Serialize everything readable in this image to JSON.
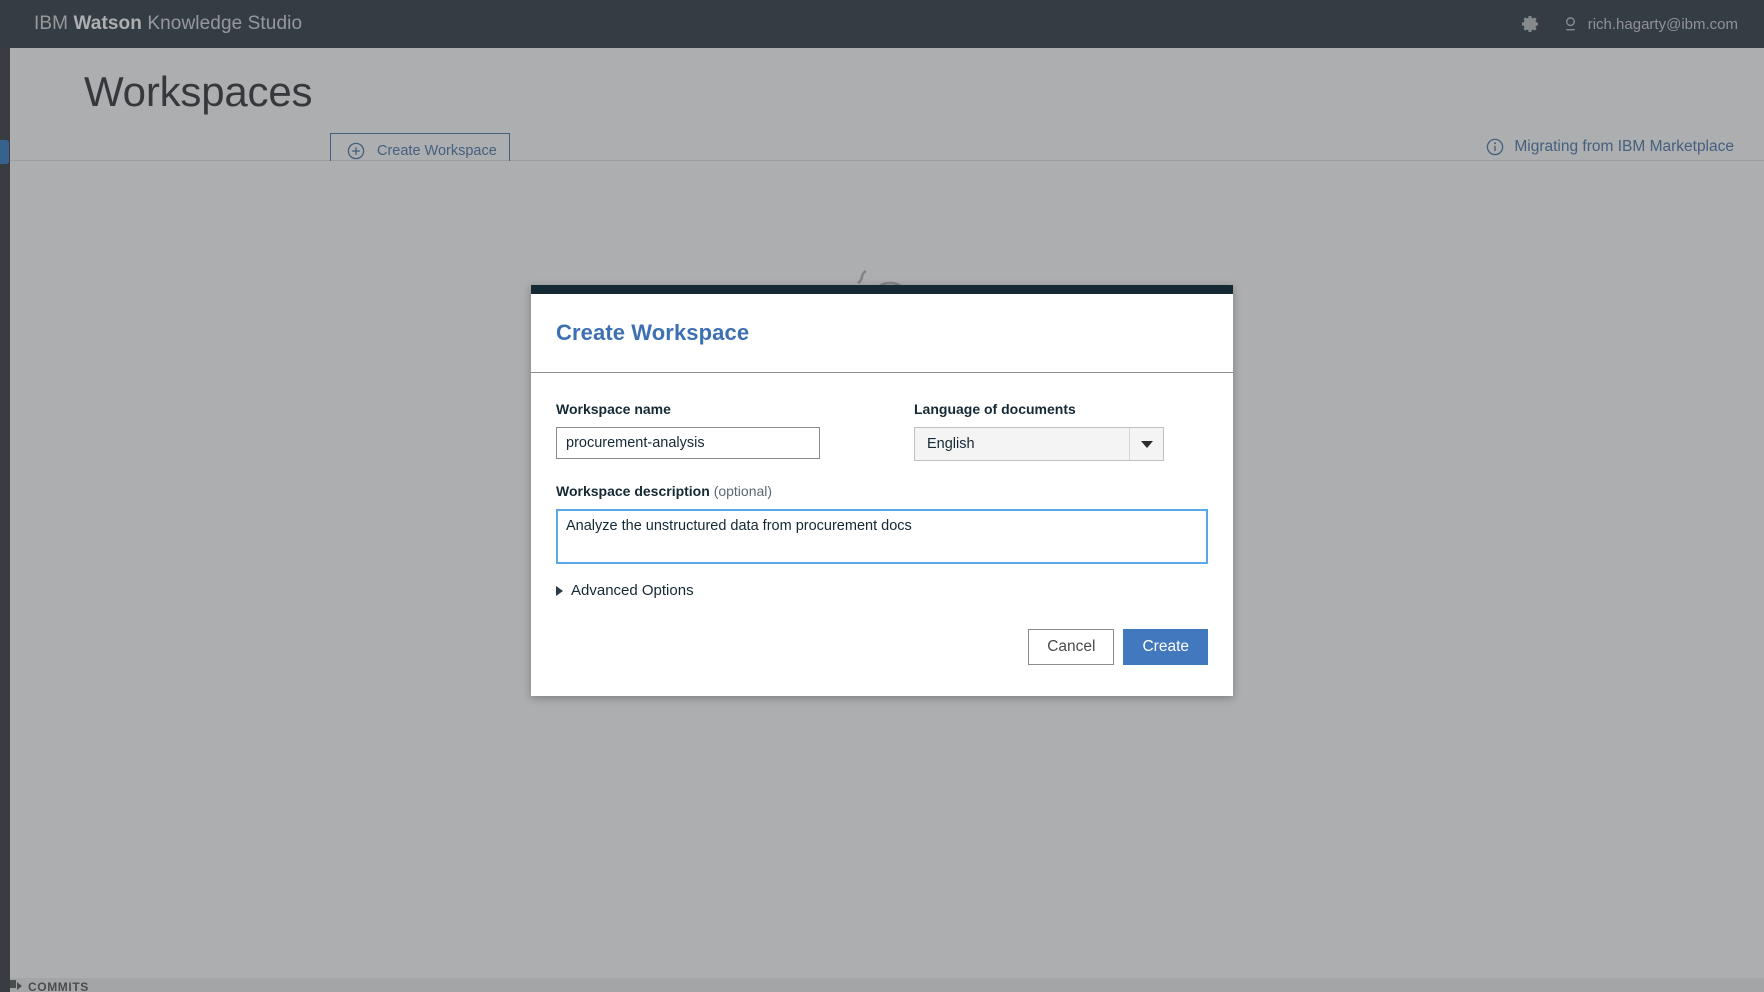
{
  "topbar": {
    "brand_prefix": "IBM ",
    "brand_bold": "Watson",
    "brand_suffix": " Knowledge Studio",
    "brand_full": "IBM Watson Knowledge Studio",
    "settings_icon": "gear-icon",
    "user_icon": "user-avatar-icon",
    "user_email": "rich.hagarty@ibm.com",
    "background_color": "#1c2a35"
  },
  "page_header": {
    "title": "Workspaces",
    "create_button": {
      "label": "Create Workspace",
      "icon": "plus-circle-icon",
      "accent_color": "#3b6ba5"
    },
    "migrating_link": {
      "label": "Migrating from IBM Marketplace",
      "icon": "info-circle-icon",
      "accent_color": "#3b6ba5"
    }
  },
  "page_body": {
    "illustration_icon": "factory-illustration-icon"
  },
  "bottom_strip": {
    "label": "COMMITS"
  },
  "modal": {
    "title": "Create Workspace",
    "title_color": "#3d70b2",
    "topbar_color": "#152935",
    "name_field": {
      "label": "Workspace name",
      "value": "procurement-analysis",
      "placeholder": ""
    },
    "language_field": {
      "label": "Language of documents",
      "value": "English",
      "arrow_icon": "chevron-down-icon",
      "options": [
        "English"
      ]
    },
    "description_field": {
      "label_main": "Workspace description ",
      "label_optional": "(optional)",
      "value": "Analyze the unstructured data from procurement docs",
      "placeholder": "",
      "focus_border_color": "#5aa7ec"
    },
    "advanced_options": {
      "label": "Advanced Options",
      "icon": "disclosure-triangle-right-icon",
      "expanded": false
    },
    "footer": {
      "cancel_label": "Cancel",
      "create_label": "Create",
      "create_color": "#4178be"
    }
  }
}
